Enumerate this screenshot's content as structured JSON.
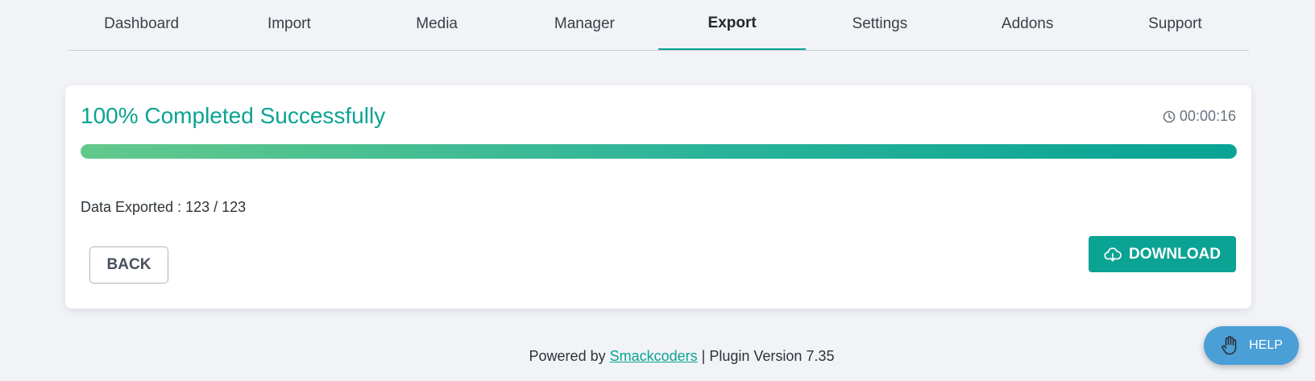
{
  "tabs": [
    {
      "label": "Dashboard"
    },
    {
      "label": "Import"
    },
    {
      "label": "Media"
    },
    {
      "label": "Manager"
    },
    {
      "label": "Export",
      "active": true
    },
    {
      "label": "Settings"
    },
    {
      "label": "Addons"
    },
    {
      "label": "Support"
    }
  ],
  "status": {
    "title": "100% Completed Successfully",
    "timer_icon": "clock-icon",
    "timer": "00:00:16",
    "progress_percent": 100,
    "exported": "Data Exported : 123 / 123"
  },
  "buttons": {
    "back_label": "BACK",
    "download_label": "DOWNLOAD",
    "download_icon": "cloud-download-icon"
  },
  "footer": {
    "powered_by": "Powered by",
    "brand_link": "Smackcoders",
    "version_text": "| Plugin Version 7.35"
  },
  "help": {
    "label": "HELP",
    "icon": "hand-icon"
  },
  "colors": {
    "accent": "#0ba394",
    "help_button": "#4a9fd6",
    "background": "#f1f3f7"
  }
}
